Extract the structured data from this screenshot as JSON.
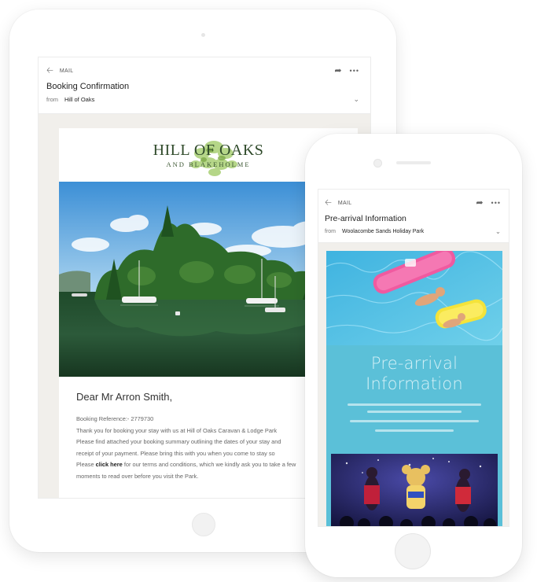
{
  "tablet": {
    "mail_label": "MAIL",
    "subject": "Booking Confirmation",
    "from_label": "from",
    "from_value": "Hill of Oaks",
    "brand": {
      "name": "HILL OF OAKS",
      "subtitle": "AND BLAKEHOLME"
    },
    "greeting": "Dear Mr Arron Smith,",
    "body_lines": [
      "Booking Reference:- 2779730",
      "Thank you for booking your stay with us at Hill of Oaks Caravan & Lodge Park",
      "Please find attached your booking summary outlining the dates of your stay and",
      "receipt of your payment. Please bring this with you when you come to stay so",
      "moments to read over before you visit the Park."
    ],
    "link_line": {
      "prefix": "Please ",
      "link": "click here",
      "suffix": " for our terms and conditions, which we kindly ask you to take a few"
    }
  },
  "phone": {
    "mail_label": "MAIL",
    "subject": "Pre-arrival Information",
    "from_label": "from",
    "from_value": "Woolacombe Sands Holiday Park",
    "hero_title_line1": "Pre-arrival",
    "hero_title_line2": "Information"
  },
  "icons": {
    "back": "back-arrow-icon",
    "share": "share-icon",
    "more": "more-icon",
    "expand": "chevron-down-icon"
  },
  "colors": {
    "email_blue": "#5bc0d8",
    "brand_green": "#2f4a2a",
    "leaf_green": "#9bc46a"
  }
}
